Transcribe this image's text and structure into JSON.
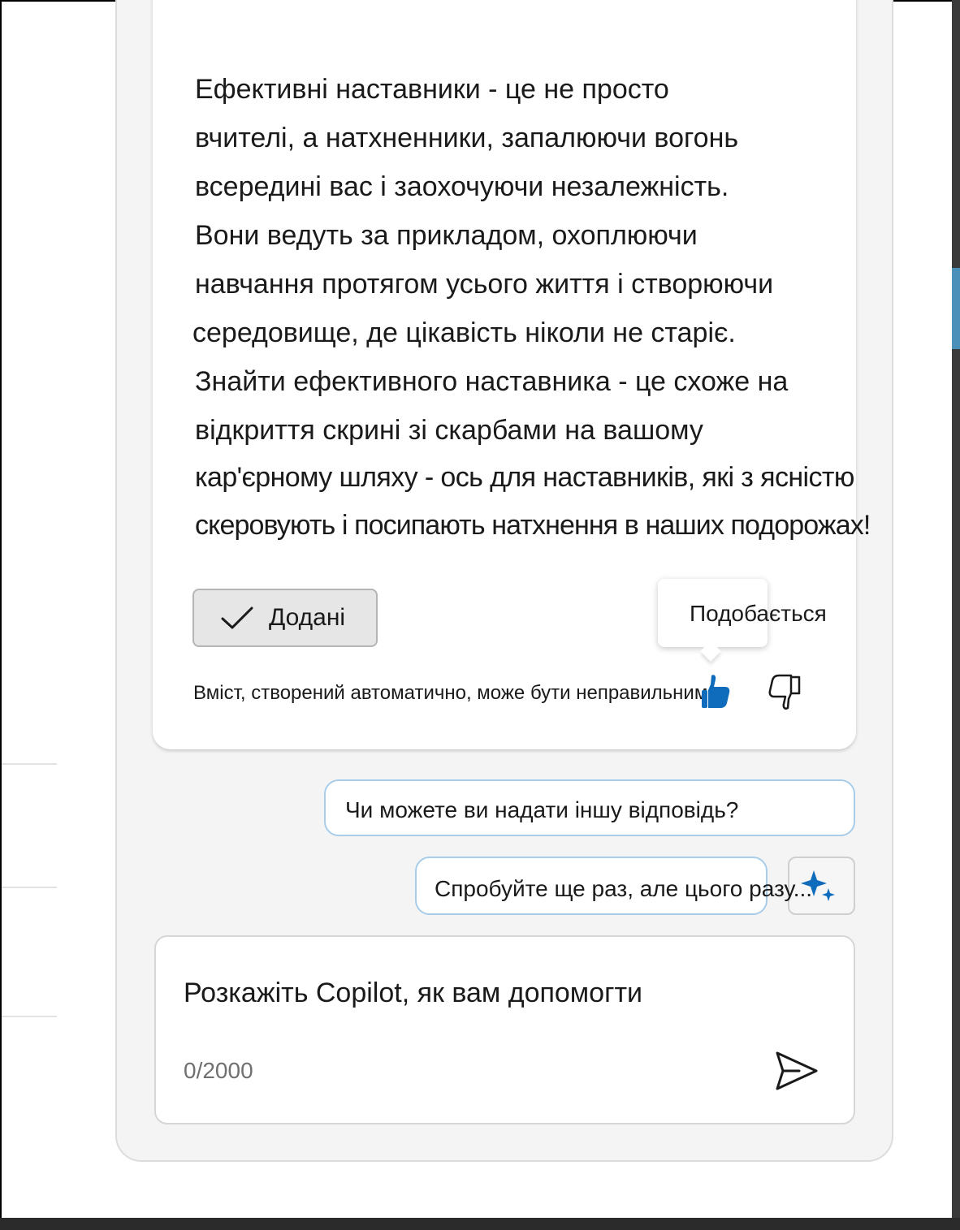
{
  "message": {
    "lines": [
      "Ефективні наставники - це не просто",
      "вчителі, а натхненники, запалюючи вогонь",
      "всередині вас і заохочуючи незалежність.",
      "Вони ведуть за прикладом, охоплюючи",
      "навчання протягом усього життя і створюючи",
      "середовище, де цікавість ніколи не старіє.",
      "Знайти ефективного наставника - це схоже на",
      "відкриття скрині зі скарбами на вашому",
      "кар'єрному шляху - ось для наставників, які з ясністю",
      "скеровують і посипають натхнення в наших подорожах!"
    ],
    "added_button_label": "Додані",
    "disclaimer": "Вміст, створений автоматично, може бути неправильним",
    "tooltip": "Подобається"
  },
  "suggestions": [
    "Чи можете ви надати іншу відповідь?",
    "Спробуйте ще раз, але цього разу..."
  ],
  "composer": {
    "placeholder": "Розкажіть Copilot, як вам допомогти",
    "char_count": "0/2000"
  },
  "colors": {
    "accent_blue": "#0f6cbd",
    "suggestion_border": "#a8cdea"
  },
  "icons": {
    "added": "checkmark-icon",
    "like": "thumbs-up-icon",
    "dislike": "thumbs-down-icon",
    "sparkle": "sparkle-icon",
    "send": "send-icon"
  }
}
